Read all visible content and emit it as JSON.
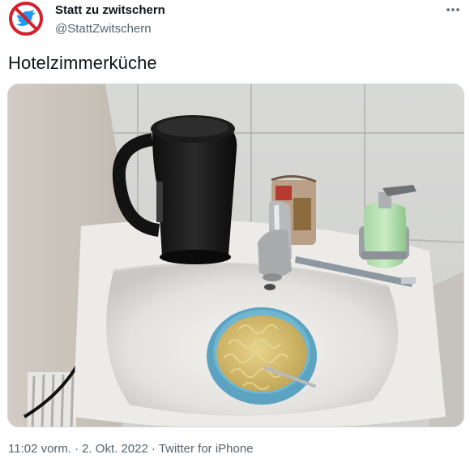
{
  "author": {
    "display_name": "Statt zu zwitschern",
    "handle": "@StattZwitschern",
    "avatar_icon": "crossed-out-bird-icon"
  },
  "menu": {
    "more_icon": "more-options-icon"
  },
  "tweet": {
    "text": "Hotelzimmerküche"
  },
  "media": {
    "kind": "photo"
  },
  "meta": {
    "time": "11:02 vorm.",
    "separator": "·",
    "date": "2. Okt. 2022",
    "source": "Twitter for iPhone"
  },
  "colors": {
    "text_primary": "#0f1419",
    "text_secondary": "#536471",
    "avatar_ring": "#d4202a",
    "avatar_bird": "#1d9bf0",
    "media_border": "#cfd9de"
  }
}
